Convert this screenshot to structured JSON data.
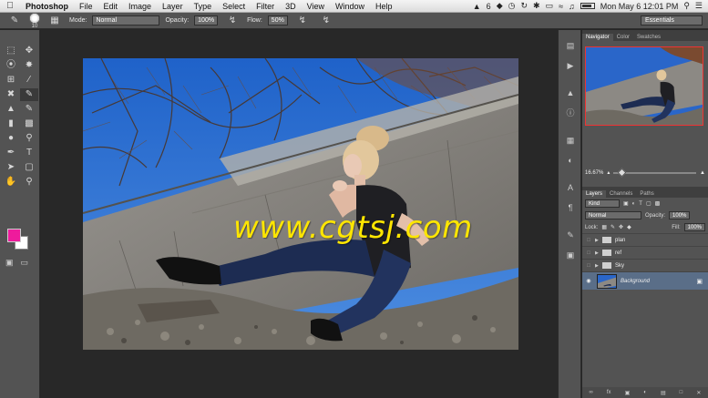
{
  "menubar": {
    "apple_icon": "apple-icon",
    "items": [
      "Photoshop",
      "File",
      "Edit",
      "Image",
      "Layer",
      "Type",
      "Select",
      "Filter",
      "3D",
      "View",
      "Window",
      "Help"
    ],
    "status_badge": "6",
    "clock": "Mon May 6  12:01 PM"
  },
  "options": {
    "brush_size": "10",
    "mode_label": "Mode:",
    "mode_value": "Normal",
    "opacity_label": "Opacity:",
    "opacity_value": "100%",
    "flow_label": "Flow:",
    "flow_value": "50%",
    "workspace": "Essentials"
  },
  "colors": {
    "foreground": "#ee1b9c",
    "background": "#ffffff",
    "watermark": "#ffe600"
  },
  "canvas": {
    "watermark_text": "www.cgtsj.com"
  },
  "navigator": {
    "tabs": [
      "Navigator",
      "Color",
      "Swatches"
    ],
    "zoom": "16.67%"
  },
  "layers_panel": {
    "tabs": [
      "Layers",
      "Channels",
      "Paths"
    ],
    "filter_kind": "Kind",
    "blend_mode": "Normal",
    "opacity_label": "Opacity:",
    "opacity_value": "100%",
    "lock_label": "Lock:",
    "fill_label": "Fill:",
    "fill_value": "100%",
    "layers": [
      {
        "name": "plan",
        "type": "group"
      },
      {
        "name": "ref",
        "type": "group"
      },
      {
        "name": "Sky",
        "type": "group"
      },
      {
        "name": "Background",
        "type": "image"
      }
    ]
  }
}
